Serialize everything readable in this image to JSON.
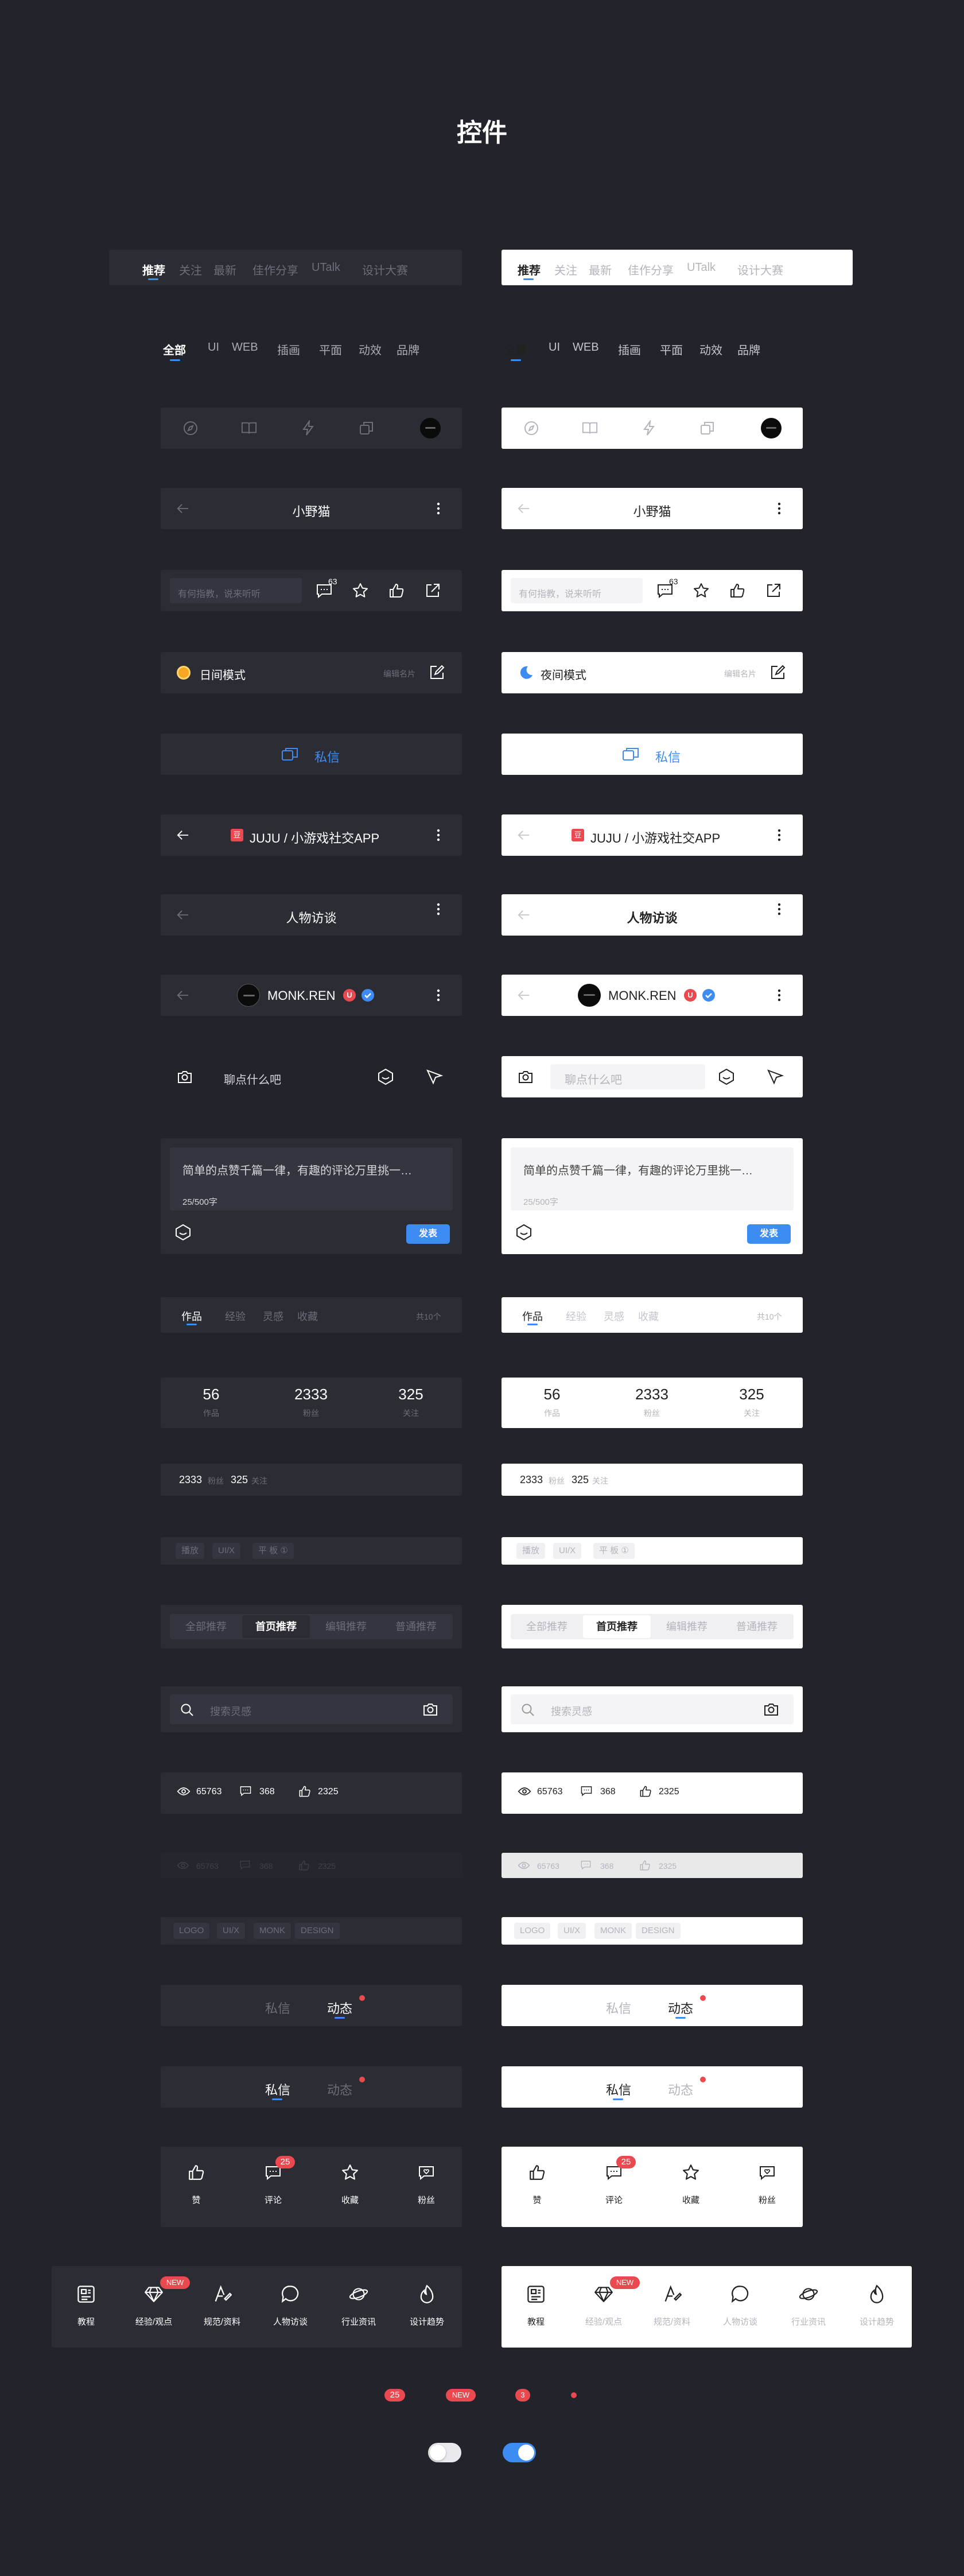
{
  "title": "控件",
  "colors": {
    "bg": "#23242b",
    "dark_panel": "#2b2c34",
    "accent": "#3d8cf2",
    "badge": "#e9494f",
    "light_panel": "#ffffff"
  },
  "tabs1": [
    "推荐",
    "关注",
    "最新",
    "佳作分享",
    "UTalk",
    "设计大赛"
  ],
  "tabs2": [
    "全部",
    "UI",
    "WEB",
    "插画",
    "平面",
    "动效",
    "品牌"
  ],
  "icon_bar": [
    "compass-icon",
    "book-icon",
    "lightning-icon",
    "layers-icon",
    "avatar-icon"
  ],
  "nav_cat": {
    "title": "小野猫"
  },
  "comment_bar": {
    "placeholder": "有何指教，说来听听",
    "badge": "63"
  },
  "mode_bar": {
    "dark_label": "日间模式",
    "light_label": "夜间模式",
    "edit": "编辑名片"
  },
  "message": {
    "label": "私信"
  },
  "app_bar": {
    "logo": "豆",
    "title": "JUJU / 小游戏社交APP"
  },
  "interview_bar": {
    "title": "人物访谈"
  },
  "user_bar": {
    "name": "MONK.REN",
    "tag": "U",
    "avatar_text": "MONK.REN"
  },
  "chat": {
    "dark_placeholder": "聊点什么吧",
    "light_placeholder": "聊点什么吧"
  },
  "editor": {
    "text": "简单的点赞千篇一律，有趣的评论万里挑一…",
    "count": "25/500字",
    "submit": "发表"
  },
  "profile_tabs": {
    "items": [
      "作品",
      "经验",
      "灵感",
      "收藏"
    ],
    "total": "共10个"
  },
  "stats": [
    {
      "value": "56",
      "label": "作品"
    },
    {
      "value": "2333",
      "label": "粉丝"
    },
    {
      "value": "325",
      "label": "关注"
    }
  ],
  "stats_inline": {
    "fans_value": "2333",
    "fans_label": "粉丝",
    "follow_value": "325",
    "follow_label": "关注"
  },
  "tags": [
    "播放",
    "UI/X",
    "平 板 ①"
  ],
  "segments": {
    "items": [
      "全部推荐",
      "首页推荐",
      "编辑推荐",
      "普通推荐"
    ],
    "active": 1
  },
  "search": {
    "placeholder": "搜索灵感"
  },
  "metrics": {
    "views": "65763",
    "comments": "368",
    "likes": "2325"
  },
  "metrics_faint": {
    "views": "65763",
    "comments": "368",
    "likes": "2325"
  },
  "keywords": [
    "LOGO",
    "UI/X",
    "MONK",
    "DESIGN"
  ],
  "msg_tabs": {
    "a": "私信",
    "b": "动态"
  },
  "actions": [
    {
      "label": "赞",
      "icon": "thumb-icon"
    },
    {
      "label": "评论",
      "icon": "comment-icon",
      "badge": "25"
    },
    {
      "label": "收藏",
      "icon": "star-icon"
    },
    {
      "label": "粉丝",
      "icon": "heart-chat-icon"
    }
  ],
  "tabbar": [
    {
      "label": "教程",
      "icon": "news-icon"
    },
    {
      "label": "经验/观点",
      "icon": "diamond-icon",
      "badge": "NEW"
    },
    {
      "label": "规范/资料",
      "icon": "pen-icon"
    },
    {
      "label": "人物访谈",
      "icon": "chat-icon"
    },
    {
      "label": "行业资讯",
      "icon": "planet-icon"
    },
    {
      "label": "设计趋势",
      "icon": "fire-icon"
    }
  ],
  "badges": {
    "number": "25",
    "new": "NEW",
    "small": "3"
  }
}
